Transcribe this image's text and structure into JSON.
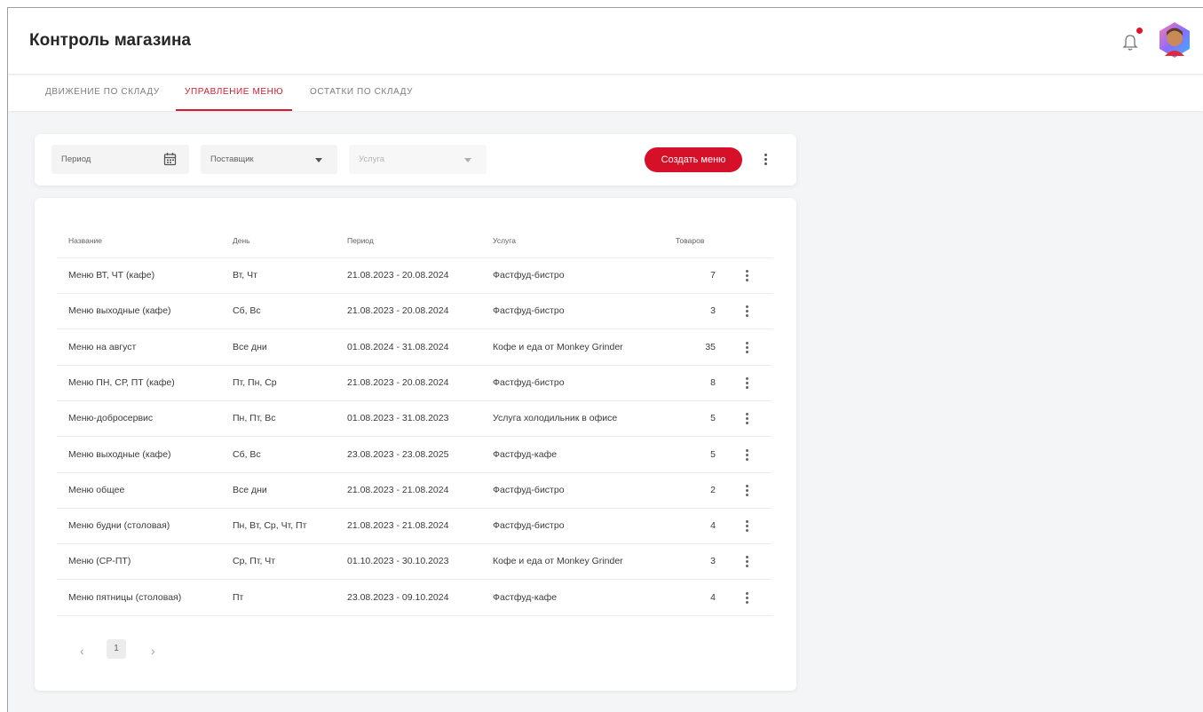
{
  "header": {
    "title": "Контроль магазина"
  },
  "tabs": [
    {
      "label": "ДВИЖЕНИЕ ПО СКЛАДУ",
      "active": false
    },
    {
      "label": "УПРАВЛЕНИЕ МЕНЮ",
      "active": true
    },
    {
      "label": "ОСТАТКИ ПО СКЛАДУ",
      "active": false
    }
  ],
  "filters": {
    "period_placeholder": "Период",
    "supplier_placeholder": "Поставщик",
    "service_placeholder": "Услуга",
    "create_button": "Создать меню"
  },
  "table": {
    "columns": [
      "Название",
      "День",
      "Период",
      "Услуга",
      "Товаров"
    ],
    "rows": [
      {
        "name": "Меню ВТ, ЧТ (кафе)",
        "days": "Вт, Чт",
        "period": "21.08.2023 - 20.08.2024",
        "service": "Фастфуд-бистро",
        "count": "7"
      },
      {
        "name": "Меню выходные (кафе)",
        "days": "Сб, Вс",
        "period": "21.08.2023 - 20.08.2024",
        "service": "Фастфуд-бистро",
        "count": "3"
      },
      {
        "name": "Меню на август",
        "days": "Все дни",
        "period": "01.08.2024 - 31.08.2024",
        "service": "Кофе и еда от Monkey Grinder",
        "count": "35"
      },
      {
        "name": "Меню ПН, СР, ПТ (кафе)",
        "days": "Пт, Пн, Ср",
        "period": "21.08.2023 - 20.08.2024",
        "service": "Фастфуд-бистро",
        "count": "8"
      },
      {
        "name": "Меню-добросервис",
        "days": "Пн, Пт, Вс",
        "period": "01.08.2023 - 31.08.2023",
        "service": "Услуга холодильник в офисе",
        "count": "5"
      },
      {
        "name": "Меню выходные (кафе)",
        "days": "Сб, Вс",
        "period": "23.08.2023 - 23.08.2025",
        "service": "Фастфуд-кафе",
        "count": "5"
      },
      {
        "name": "Меню общее",
        "days": "Все дни",
        "period": "21.08.2023 - 21.08.2024",
        "service": "Фастфуд-бистро",
        "count": "2"
      },
      {
        "name": "Меню будни (столовая)",
        "days": "Пн, Вт, Ср, Чт, Пт",
        "period": "21.08.2023 - 21.08.2024",
        "service": "Фастфуд-бистро",
        "count": "4"
      },
      {
        "name": "Меню (СР-ПТ)",
        "days": "Ср, Пт, Чт",
        "period": "01.10.2023 - 30.10.2023",
        "service": "Кофе и еда от Monkey Grinder",
        "count": "3"
      },
      {
        "name": "Меню пятницы (столовая)",
        "days": "Пт",
        "period": "23.08.2023 - 09.10.2024",
        "service": "Фастфуд-кафе",
        "count": "4"
      }
    ]
  },
  "pagination": {
    "prev": "‹",
    "page": "1",
    "next": "›"
  },
  "colors": {
    "accent": "#d7102a",
    "background": "#f4f5f7",
    "notification_dot": "#e0142d"
  },
  "icons": [
    "bell-icon",
    "avatar",
    "calendar-icon",
    "chevron-down-icon",
    "more-vert-icon"
  ]
}
